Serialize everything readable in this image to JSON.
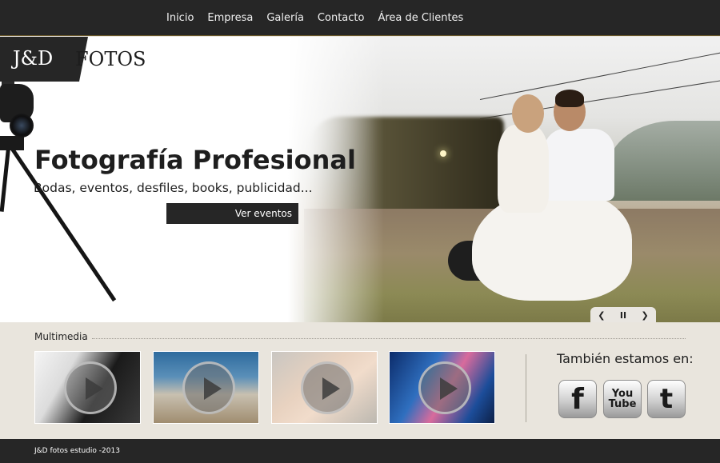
{
  "nav": {
    "items": [
      "Inicio",
      "Empresa",
      "Galería",
      "Contacto",
      "Área de Clientes"
    ]
  },
  "logo": {
    "brand": "J&D",
    "word": "FOTOS"
  },
  "hero": {
    "title": "Fotografía Profesional",
    "subtitle": "Bodas, eventos, desfiles, books, publicidad...",
    "cta_label": "Ver eventos",
    "controls": {
      "prev": "❮",
      "pause": "II",
      "next": "❯"
    }
  },
  "multimedia": {
    "label": "Multimedia",
    "thumbnails": [
      "couple-dark-video",
      "beach-couple-video",
      "baby-video",
      "graffiti-dancer-video"
    ]
  },
  "social": {
    "title": "También estamos en:",
    "facebook": "f",
    "youtube": "You Tube",
    "twitter": "t"
  },
  "footer": {
    "text": "J&D fotos estudio -2013"
  },
  "colors": {
    "bar": "#262626",
    "page": "#e9e5dd",
    "accent": "#6b5a2a"
  }
}
